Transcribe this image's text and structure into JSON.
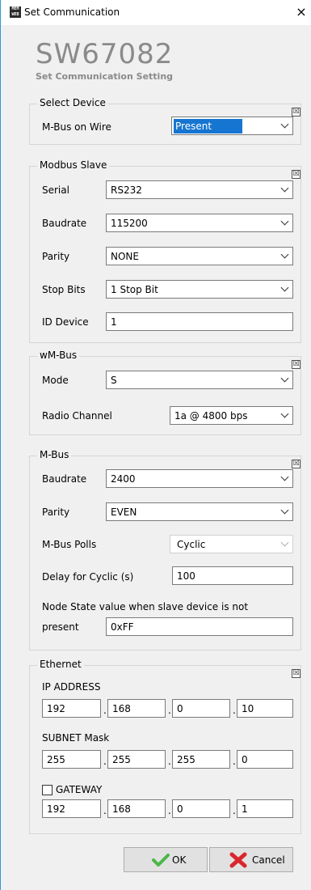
{
  "window": {
    "icon_text": "MEM\nWEB",
    "title": "Set Communication",
    "close_glyph": "×"
  },
  "header": {
    "brand": "SW67082",
    "subtitle": "Set Communication Setting"
  },
  "group_close_glyph": "☒",
  "select_device": {
    "title": "Select Device",
    "mbus_on_wire_label": "M-Bus on Wire",
    "mbus_on_wire_value": "Present"
  },
  "modbus_slave": {
    "title": "Modbus Slave",
    "serial_label": "Serial",
    "serial_value": "RS232",
    "baudrate_label": "Baudrate",
    "baudrate_value": "115200",
    "parity_label": "Parity",
    "parity_value": "NONE",
    "stopbits_label": "Stop Bits",
    "stopbits_value": "1 Stop Bit",
    "id_label": "ID Device",
    "id_value": "1"
  },
  "wmbus": {
    "title": "wM-Bus",
    "mode_label": "Mode",
    "mode_value": "S",
    "radio_label": "Radio Channel",
    "radio_value": "1a @ 4800 bps"
  },
  "mbus": {
    "title": "M-Bus",
    "baudrate_label": "Baudrate",
    "baudrate_value": "2400",
    "parity_label": "Parity",
    "parity_value": "EVEN",
    "polls_label": "M-Bus Polls",
    "polls_value": "Cyclic",
    "delay_label": "Delay for Cyclic (s)",
    "delay_value": "100",
    "node_state_label_1": "Node State value when slave device is not",
    "node_state_label_2": "present",
    "node_state_value": "0xFF"
  },
  "ethernet": {
    "title": "Ethernet",
    "ip_label": "IP ADDRESS",
    "ip": [
      "192",
      "168",
      "0",
      "10"
    ],
    "subnet_label": "SUBNET Mask",
    "subnet": [
      "255",
      "255",
      "255",
      "0"
    ],
    "gateway_label": "GATEWAY",
    "gateway_checked": false,
    "gateway": [
      "192",
      "168",
      "0",
      "1"
    ],
    "separator": "."
  },
  "buttons": {
    "ok_label": "OK",
    "cancel_label": "Cancel"
  },
  "colors": {
    "accent": "#1675d1",
    "ok_icon": "#4cb648",
    "cancel_icon": "#d9262c",
    "brand_text": "#8a8a8a"
  }
}
